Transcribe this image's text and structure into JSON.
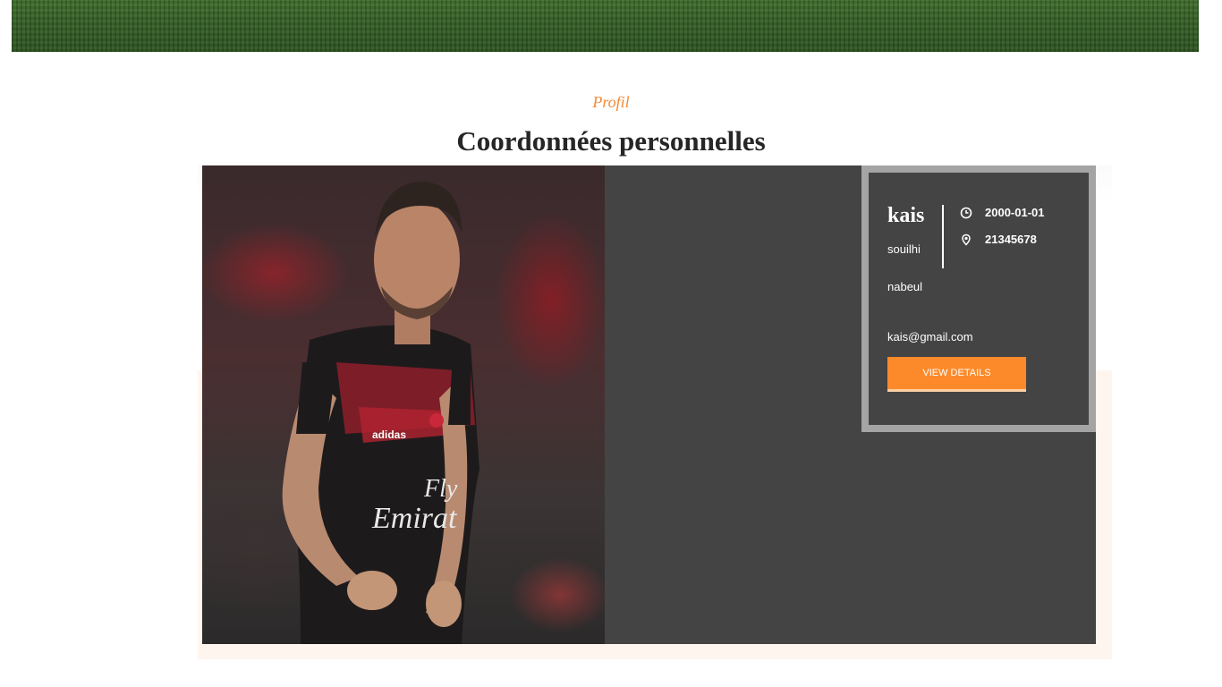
{
  "header": {
    "subtitle": "Profil",
    "title": "Coordonnées personnelles"
  },
  "profile": {
    "first_name": "kais",
    "last_name": "souilhi",
    "birth_date": "2000-01-01",
    "phone": "21345678",
    "city": "nabeul",
    "email": "kais@gmail.com",
    "button_label": "VIEW DETAILS",
    "photo_alt": "player-photo"
  },
  "colors": {
    "accent": "#f08a3a",
    "button": "#fd8a2a",
    "card_bg": "#444444",
    "info_border": "#a4a4a4"
  },
  "icons": {
    "date": "clock-icon",
    "phone": "location-pin-icon"
  }
}
